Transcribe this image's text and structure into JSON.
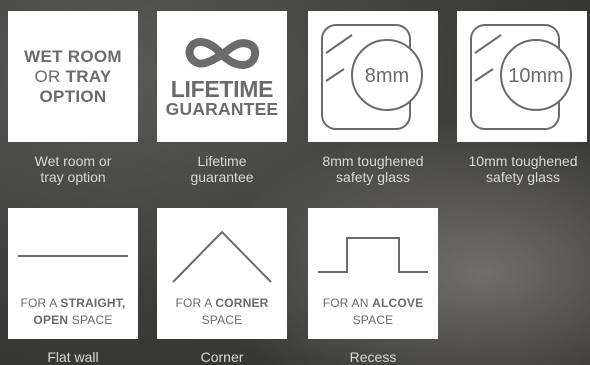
{
  "features": {
    "wet_room": {
      "tile_line1": "WET ROOM",
      "tile_line2_prefix": "OR ",
      "tile_line2_bold": "TRAY",
      "tile_line3": "OPTION",
      "caption_line1": "Wet room or",
      "caption_line2": "tray option"
    },
    "lifetime": {
      "icon": "infinity-icon",
      "tile_line1": "LIFETIME",
      "tile_line2": "GUARANTEE",
      "caption_line1": "Lifetime",
      "caption_line2": "guarantee"
    },
    "glass_8mm": {
      "icon": "glass-panel-icon",
      "badge": "8mm",
      "caption_line1": "8mm toughened",
      "caption_line2": "safety glass"
    },
    "glass_10mm": {
      "icon": "glass-panel-icon",
      "badge": "10mm",
      "caption_line1": "10mm toughened",
      "caption_line2": "safety glass"
    }
  },
  "spaces": {
    "flat": {
      "icon": "flat-wall-icon",
      "label_prefix": "FOR A ",
      "label_bold": "STRAIGHT,",
      "label_line2_bold": "OPEN",
      "label_line2_suffix": " SPACE",
      "caption": "Flat wall"
    },
    "corner": {
      "icon": "corner-icon",
      "label_prefix": "FOR A ",
      "label_bold": "CORNER",
      "label_line2": "SPACE",
      "caption": "Corner"
    },
    "recess": {
      "icon": "recess-icon",
      "label_prefix": "FOR AN ",
      "label_bold": "ALCOVE",
      "label_line2": "SPACE",
      "caption": "Recess"
    }
  },
  "colors": {
    "tile_background": "#ffffff",
    "tile_text": "#6b6b6b",
    "caption_text": "#d9d9d9"
  }
}
